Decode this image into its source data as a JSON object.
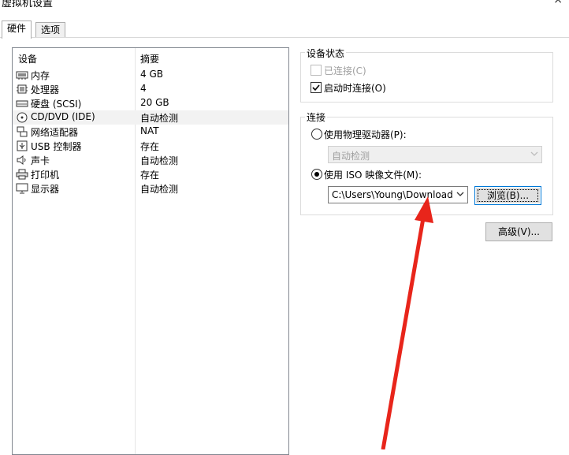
{
  "window": {
    "title": "虚拟机设置"
  },
  "tabs": [
    {
      "label": "硬件"
    },
    {
      "label": "选项"
    }
  ],
  "devices": {
    "header_device": "设备",
    "header_summary": "摘要",
    "items": [
      {
        "name": "内存",
        "summary": "4 GB",
        "icon": "memory-icon"
      },
      {
        "name": "处理器",
        "summary": "4",
        "icon": "processor-icon"
      },
      {
        "name": "硬盘 (SCSI)",
        "summary": "20 GB",
        "icon": "hard-disk-icon"
      },
      {
        "name": "CD/DVD (IDE)",
        "summary": "自动检测",
        "icon": "cd-dvd-icon"
      },
      {
        "name": "网络适配器",
        "summary": "NAT",
        "icon": "network-adapter-icon"
      },
      {
        "name": "USB 控制器",
        "summary": "存在",
        "icon": "usb-controller-icon"
      },
      {
        "name": "声卡",
        "summary": "自动检测",
        "icon": "sound-card-icon"
      },
      {
        "name": "打印机",
        "summary": "存在",
        "icon": "printer-icon"
      },
      {
        "name": "显示器",
        "summary": "自动检测",
        "icon": "display-icon"
      }
    ],
    "selected_index": 3
  },
  "device_status": {
    "title": "设备状态",
    "connected_label": "已连接(C)",
    "connected_checked": false,
    "connect_on_power_label": "启动时连接(O)",
    "connect_on_power_checked": true
  },
  "connection": {
    "title": "连接",
    "physical_drive_label": "使用物理驱动器(P):",
    "physical_drive_value": "自动检测",
    "iso_label": "使用 ISO 映像文件(M):",
    "iso_path": "C:\\Users\\Young\\Downloads\\",
    "browse_label": "浏览(B)...",
    "selected_option": "iso"
  },
  "advanced_label": "高级(V)...",
  "colors": {
    "annotation_arrow": "#e8251b",
    "focus_border": "#0078d7"
  }
}
